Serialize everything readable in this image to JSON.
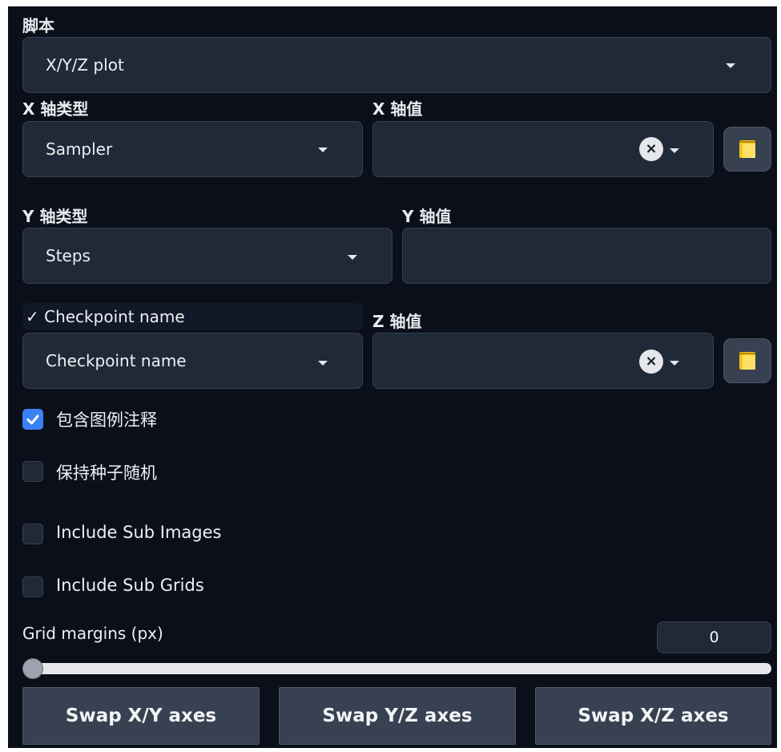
{
  "script_section": {
    "label": "脚本",
    "selected": "X/Y/Z plot"
  },
  "x_axis": {
    "type_label": "X 轴类型",
    "type_value": "Sampler",
    "values_label": "X 轴值",
    "values_value": ""
  },
  "y_axis": {
    "type_label": "Y 轴类型",
    "type_value": "Steps",
    "values_label": "Y 轴值",
    "values_value": ""
  },
  "z_axis": {
    "dropdown_option": "✓ Checkpoint name",
    "type_value": "Checkpoint name",
    "values_label": "Z 轴值",
    "values_value": ""
  },
  "options": [
    {
      "label": "包含图例注释",
      "checked": true
    },
    {
      "label": "保持种子随机",
      "checked": false
    },
    {
      "label": "Include Sub Images",
      "checked": false
    },
    {
      "label": "Include Sub Grids",
      "checked": false
    }
  ],
  "grid_margins": {
    "label": "Grid margins (px)",
    "value": "0",
    "slider_fraction": 0
  },
  "buttons": {
    "swap_xy": "Swap X/Y axes",
    "swap_yz": "Swap Y/Z axes",
    "swap_xz": "Swap X/Z axes"
  },
  "icons": {
    "clear": "×",
    "fill_values": "notepad-icon"
  },
  "colors": {
    "panel_bg": "#0b0f19",
    "field_bg": "#1f2937",
    "accent": "#3b82f6"
  }
}
